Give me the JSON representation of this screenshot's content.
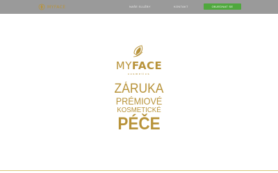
{
  "header": {
    "logo_text": "MYFACE",
    "nav": [
      {
        "label": "Naše Služby"
      },
      {
        "label": "Kontakt"
      }
    ],
    "cta_label": "Objednat se"
  },
  "hero": {
    "brand_light": "MY",
    "brand_bold": "FACE",
    "brand_sub": "cosmetics",
    "tagline": [
      "ZÁRUKA",
      "PRÉMIOVÉ",
      "KOSMETICKÉ",
      "PÉČE"
    ]
  },
  "colors": {
    "gold": "#b8933a",
    "header_bg": "#9a9a9a",
    "cta_bg": "#4fa83d"
  }
}
